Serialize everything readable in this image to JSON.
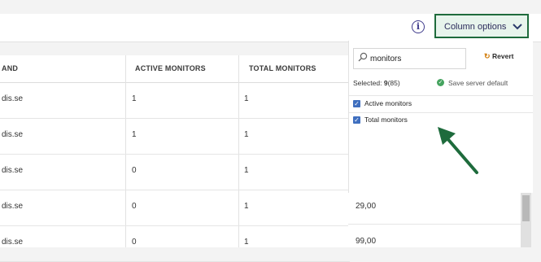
{
  "toolbar": {
    "info_icon": "info-circle-icon",
    "column_options_label": "Column options",
    "chevron_icon": "chevron-down-icon"
  },
  "table": {
    "headers": [
      "AND",
      "ACTIVE MONITORS",
      "TOTAL MONITORS"
    ],
    "rows": [
      [
        "dis.se",
        "1",
        "1"
      ],
      [
        "dis.se",
        "1",
        "1"
      ],
      [
        "dis.se",
        "0",
        "1"
      ],
      [
        "dis.se",
        "0",
        "1"
      ],
      [
        "dis.se",
        "0",
        "1"
      ]
    ],
    "extra_values": [
      "29,00",
      "99,00"
    ]
  },
  "column_panel": {
    "search_value": "monitors",
    "revert_label": "Revert",
    "selected_label": "Selected:",
    "selected_count": "9",
    "selected_total": "(85)",
    "save_default_label": "Save server default",
    "options": [
      {
        "label": "Active monitors",
        "checked": true
      },
      {
        "label": "Total monitors",
        "checked": true
      }
    ]
  },
  "colors": {
    "accent_green": "#1e6b3c",
    "checkbox_blue": "#3f6fbf",
    "info_purple": "#3f3b8c"
  }
}
